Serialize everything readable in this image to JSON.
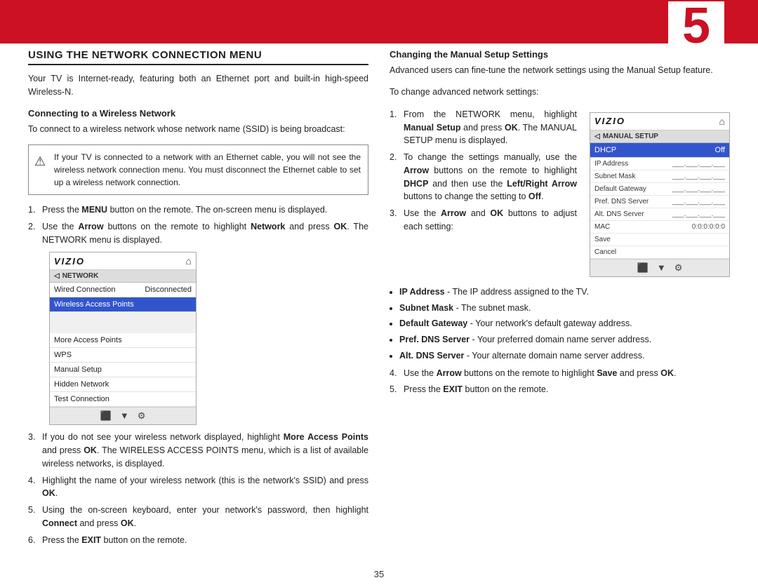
{
  "header": {
    "chapter_number": "5",
    "bar_color": "#cc1122"
  },
  "left_column": {
    "section_title": "USING THE NETWORK CONNECTION MENU",
    "intro": "Your TV is Internet-ready, featuring both an Ethernet port and built-in high-speed Wireless-N.",
    "subsection1": "Connecting to a Wireless Network",
    "subsection1_intro": "To connect to a wireless network whose network name (SSID) is being broadcast:",
    "warning_text": "If your TV is connected to a network with an Ethernet cable, you will not see the wireless network connection menu. You must disconnect the Ethernet cable to set up a wireless network connection.",
    "steps": [
      {
        "num": "1.",
        "text_parts": [
          {
            "text": "Press the ",
            "bold": false
          },
          {
            "text": "MENU",
            "bold": true
          },
          {
            "text": " button on the remote. The on-screen menu is displayed.",
            "bold": false
          }
        ]
      },
      {
        "num": "2.",
        "text_parts": [
          {
            "text": "Use the ",
            "bold": false
          },
          {
            "text": "Arrow",
            "bold": true
          },
          {
            "text": " buttons on the remote to highlight ",
            "bold": false
          },
          {
            "text": "Network",
            "bold": true
          },
          {
            "text": " and press ",
            "bold": false
          },
          {
            "text": "OK",
            "bold": true
          },
          {
            "text": ". The NETWORK menu is displayed.",
            "bold": false
          }
        ]
      },
      {
        "num": "3.",
        "text_parts": [
          {
            "text": "If you do not see your wireless network displayed, highlight ",
            "bold": false
          },
          {
            "text": "More Access Points",
            "bold": true
          },
          {
            "text": " and press ",
            "bold": false
          },
          {
            "text": "OK",
            "bold": true
          },
          {
            "text": ". The WIRELESS ACCESS POINTS menu, which is a list of available wireless networks, is displayed.",
            "bold": false
          }
        ]
      },
      {
        "num": "4.",
        "text_parts": [
          {
            "text": "Highlight the name of your wireless network (this is the network’s SSID) and press ",
            "bold": false
          },
          {
            "text": "OK",
            "bold": true
          },
          {
            "text": ".",
            "bold": false
          }
        ]
      },
      {
        "num": "5.",
        "text_parts": [
          {
            "text": "Using the on-screen keyboard, enter your network’s password, then highlight ",
            "bold": false
          },
          {
            "text": "Connect",
            "bold": true
          },
          {
            "text": " and press ",
            "bold": false
          },
          {
            "text": "OK",
            "bold": true
          },
          {
            "text": ".",
            "bold": false
          }
        ]
      },
      {
        "num": "6.",
        "text_parts": [
          {
            "text": "Press the ",
            "bold": false
          },
          {
            "text": "EXIT",
            "bold": true
          },
          {
            "text": " button on the remote.",
            "bold": false
          }
        ]
      }
    ],
    "network_ui": {
      "logo": "VIZIO",
      "nav_label": "NETWORK",
      "rows": [
        {
          "label": "Wired Connection",
          "value": "Disconnected",
          "highlighted": false
        },
        {
          "label": "Wireless Access Points",
          "value": "",
          "highlighted": true
        },
        {
          "label": "",
          "value": "",
          "spacer": true
        },
        {
          "label": "More Access Points",
          "value": "",
          "highlighted": false
        },
        {
          "label": "WPS",
          "value": "",
          "highlighted": false
        },
        {
          "label": "Manual Setup",
          "value": "",
          "highlighted": false
        },
        {
          "label": "Hidden Network",
          "value": "",
          "highlighted": false
        },
        {
          "label": "Test Connection",
          "value": "",
          "highlighted": false
        }
      ],
      "footer_icons": [
        "⬛",
        "▼",
        "⚙"
      ]
    }
  },
  "right_column": {
    "subsection_heading": "Changing the Manual Setup Settings",
    "intro": "Advanced users can fine-tune the network settings using the Manual Setup feature.",
    "step_intro": "To change advanced network settings:",
    "steps": [
      {
        "num": "1.",
        "text_parts": [
          {
            "text": "From the NETWORK menu, highlight ",
            "bold": false
          },
          {
            "text": "Manual Setup",
            "bold": true
          },
          {
            "text": " and press ",
            "bold": false
          },
          {
            "text": "OK",
            "bold": true
          },
          {
            "text": ". The MANUAL SETUP menu is displayed.",
            "bold": false
          }
        ]
      },
      {
        "num": "2.",
        "text_parts": [
          {
            "text": "To change the settings manually, use the ",
            "bold": false
          },
          {
            "text": "Arrow",
            "bold": true
          },
          {
            "text": " buttons on the remote to highlight ",
            "bold": false
          },
          {
            "text": "DHCP",
            "bold": true
          },
          {
            "text": " and then use the ",
            "bold": false
          },
          {
            "text": "Left/Right Arrow",
            "bold": true
          },
          {
            "text": " buttons to change the setting to ",
            "bold": false
          },
          {
            "text": "Off",
            "bold": true
          },
          {
            "text": ".",
            "bold": false
          }
        ]
      },
      {
        "num": "3.",
        "text_parts": [
          {
            "text": "Use the ",
            "bold": false
          },
          {
            "text": "Arrow",
            "bold": true
          },
          {
            "text": " and ",
            "bold": false
          },
          {
            "text": "OK",
            "bold": true
          },
          {
            "text": " buttons to adjust each setting:",
            "bold": false
          }
        ]
      }
    ],
    "bullets": [
      {
        "label": "IP Address",
        "text": " - The IP address assigned to the TV."
      },
      {
        "label": "Subnet Mask",
        "text": " - The subnet mask."
      },
      {
        "label": "Default Gateway",
        "text": " - Your network’s default gateway address."
      },
      {
        "label": "Pref. DNS Server",
        "text": " - Your preferred domain name server address."
      },
      {
        "label": "Alt. DNS Server",
        "text": " - Your alternate domain name server address."
      }
    ],
    "steps_after": [
      {
        "num": "4.",
        "text_parts": [
          {
            "text": "Use the ",
            "bold": false
          },
          {
            "text": "Arrow",
            "bold": true
          },
          {
            "text": " buttons on the remote to highlight ",
            "bold": false
          },
          {
            "text": "Save",
            "bold": true
          },
          {
            "text": " and press ",
            "bold": false
          },
          {
            "text": "OK",
            "bold": true
          },
          {
            "text": ".",
            "bold": false
          }
        ]
      },
      {
        "num": "5.",
        "text_parts": [
          {
            "text": "Press the ",
            "bold": false
          },
          {
            "text": "EXIT",
            "bold": true
          },
          {
            "text": " button on the remote.",
            "bold": false
          }
        ]
      }
    ],
    "manual_setup_ui": {
      "logo": "VIZIO",
      "nav_label": "MANUAL SETUP",
      "rows": [
        {
          "label": "DHCP",
          "value": "Off",
          "highlighted": true
        },
        {
          "label": "IP Address",
          "value": "___.___.___.___ ",
          "highlighted": false
        },
        {
          "label": "Subnet Mask",
          "value": "___.___.___.___ ",
          "highlighted": false
        },
        {
          "label": "Default Gateway",
          "value": "___.___.___.___ ",
          "highlighted": false
        },
        {
          "label": "Pref. DNS Server",
          "value": "___.___.___.___ ",
          "highlighted": false
        },
        {
          "label": "Alt. DNS Server",
          "value": "___.___.___.___ ",
          "highlighted": false
        },
        {
          "label": "MAC",
          "value": "0:0:0:0:0:0",
          "highlighted": false
        },
        {
          "label": "Save",
          "value": "",
          "highlighted": false
        },
        {
          "label": "Cancel",
          "value": "",
          "highlighted": false
        }
      ],
      "footer_icons": [
        "⬛",
        "▼",
        "⚙"
      ]
    }
  },
  "page_number": "35"
}
